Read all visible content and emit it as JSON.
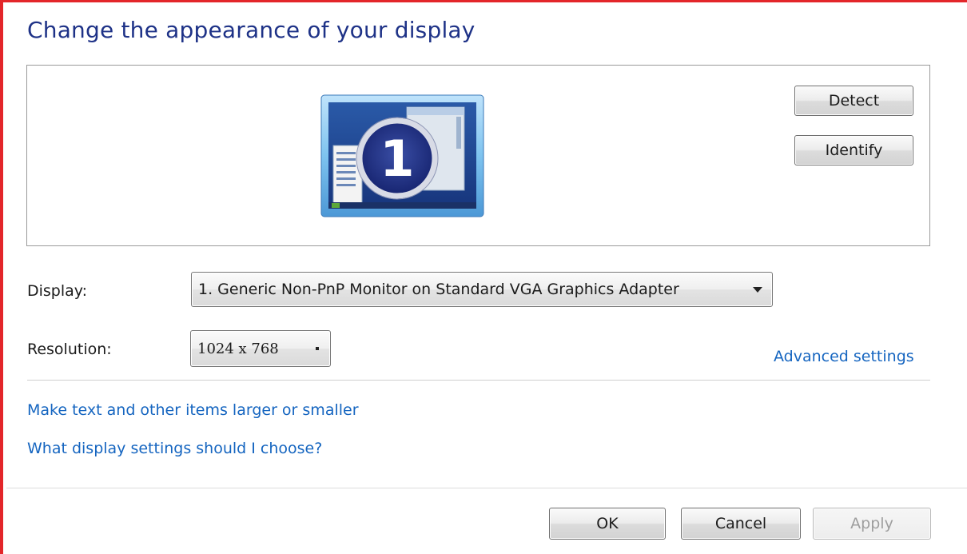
{
  "window": {
    "title": "Change the appearance of your display"
  },
  "preview": {
    "monitor_number": "1",
    "detect_label": "Detect",
    "identify_label": "Identify"
  },
  "display": {
    "label": "Display:",
    "selected": "1. Generic Non-PnP Monitor on Standard VGA Graphics Adapter"
  },
  "resolution": {
    "label": "Resolution:",
    "selected": "1024 x 768"
  },
  "links": {
    "advanced_settings": "Advanced settings",
    "text_size": "Make text and other items larger or smaller",
    "help": "What display settings should I choose?"
  },
  "footer": {
    "ok_label": "OK",
    "cancel_label": "Cancel",
    "apply_label": "Apply"
  },
  "colors": {
    "title": "#1e3287",
    "link": "#1565c0",
    "frame_accent": "#e3262a"
  },
  "icons": {
    "monitor": "monitor-icon",
    "dropdown": "chevron-down-icon"
  }
}
